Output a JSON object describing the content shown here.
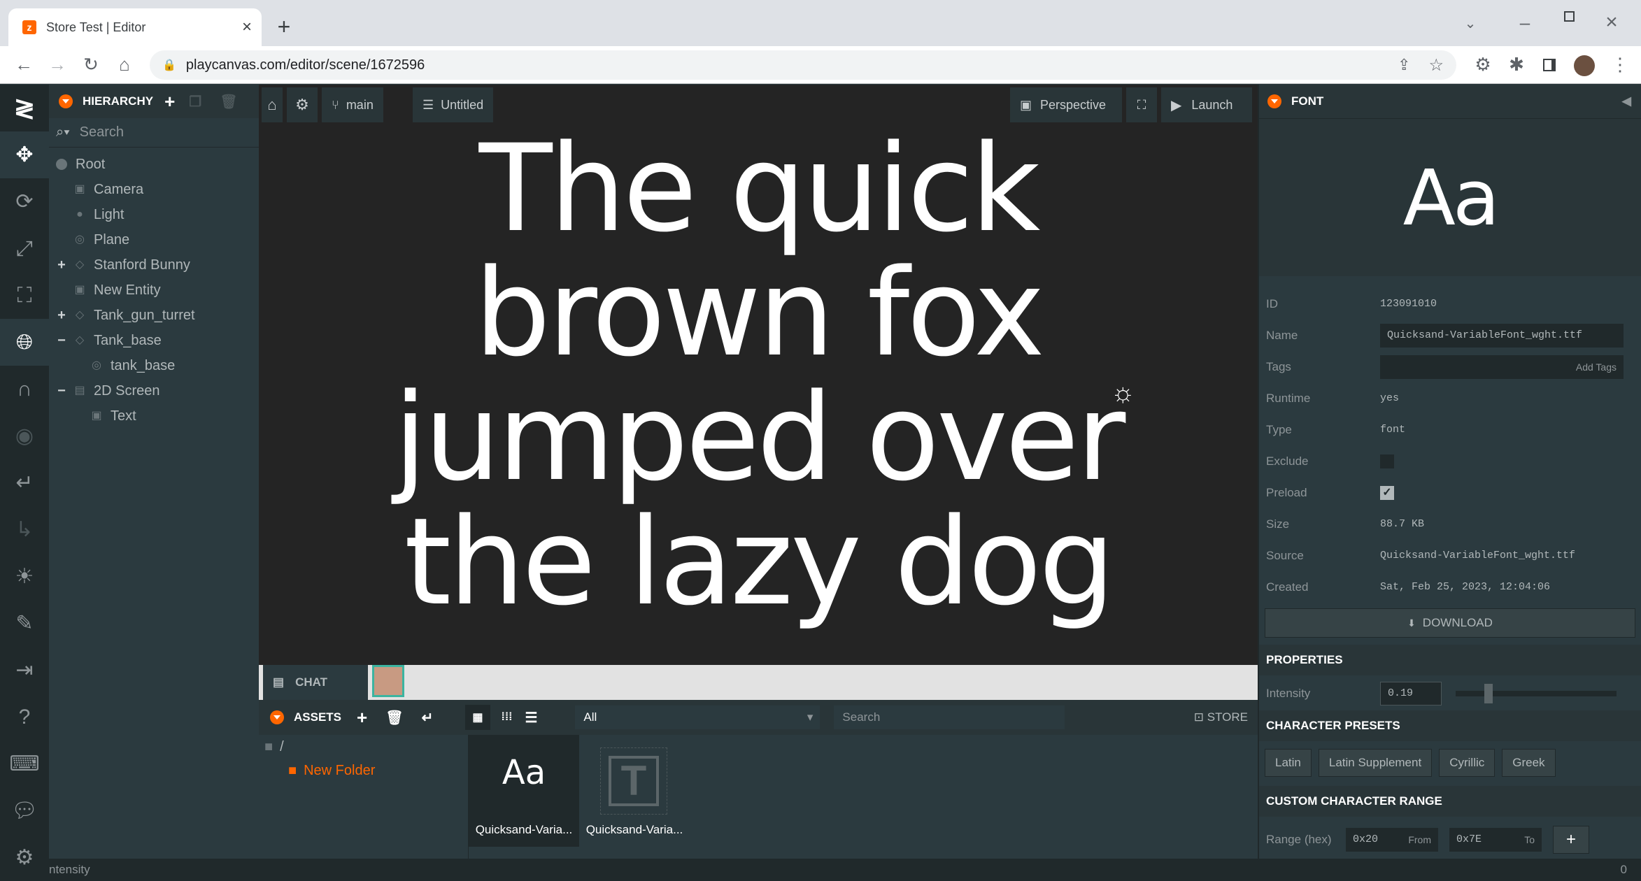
{
  "browser": {
    "tab_title": "Store Test | Editor",
    "url": "playcanvas.com/editor/scene/1672596"
  },
  "hierarchy": {
    "title": "HIERARCHY",
    "search_placeholder": "Search",
    "items": [
      {
        "label": "Root"
      },
      {
        "label": "Camera"
      },
      {
        "label": "Light"
      },
      {
        "label": "Plane"
      },
      {
        "label": "Stanford Bunny"
      },
      {
        "label": "New Entity"
      },
      {
        "label": "Tank_gun_turret"
      },
      {
        "label": "Tank_base"
      },
      {
        "label": "tank_base"
      },
      {
        "label": "2D Screen"
      },
      {
        "label": "Text"
      }
    ]
  },
  "viewport": {
    "branch": "main",
    "scene": "Untitled",
    "camera": "Perspective",
    "launch": "Launch",
    "text": "The quick brown fox jumped over the lazy dog",
    "lines": [
      "The quick",
      "brown fox",
      "jumped over",
      "the lazy dog"
    ],
    "chat": "CHAT"
  },
  "assets": {
    "title": "ASSETS",
    "filter": "All",
    "search_placeholder": "Search",
    "store": "STORE",
    "root": "/",
    "folder": "New Folder",
    "items": [
      {
        "label": "Quicksand-Varia...",
        "glyph": "Aa"
      },
      {
        "label": "Quicksand-Varia...",
        "glyph": "T"
      }
    ]
  },
  "font_panel": {
    "title": "FONT",
    "preview": "Aa",
    "fields": {
      "id_label": "ID",
      "id": "123091010",
      "name_label": "Name",
      "name": "Quicksand-VariableFont_wght.ttf",
      "tags_label": "Tags",
      "tags_placeholder": "Add Tags",
      "runtime_label": "Runtime",
      "runtime": "yes",
      "type_label": "Type",
      "type": "font",
      "exclude_label": "Exclude",
      "preload_label": "Preload",
      "size_label": "Size",
      "size": "88.7 KB",
      "source_label": "Source",
      "source": "Quicksand-VariableFont_wght.ttf",
      "created_label": "Created",
      "created": "Sat, Feb 25, 2023, 12:04:06"
    },
    "download": "DOWNLOAD",
    "properties_title": "PROPERTIES",
    "intensity_label": "Intensity",
    "intensity": "0.19",
    "intensity_value": 0.19,
    "presets_title": "CHARACTER PRESETS",
    "presets": [
      "Latin",
      "Latin Supplement",
      "Cyrillic",
      "Greek"
    ],
    "range_title": "CUSTOM CHARACTER RANGE",
    "range_label": "Range (hex)",
    "range_from": "0x20",
    "from_label": "From",
    "range_to": "0x7E",
    "to_label": "To"
  },
  "status": {
    "left": "ntensity",
    "right": "0"
  },
  "colors": {
    "accent": "#ff6600",
    "panel": "#2b3a3f",
    "toolbar": "#20292b"
  }
}
